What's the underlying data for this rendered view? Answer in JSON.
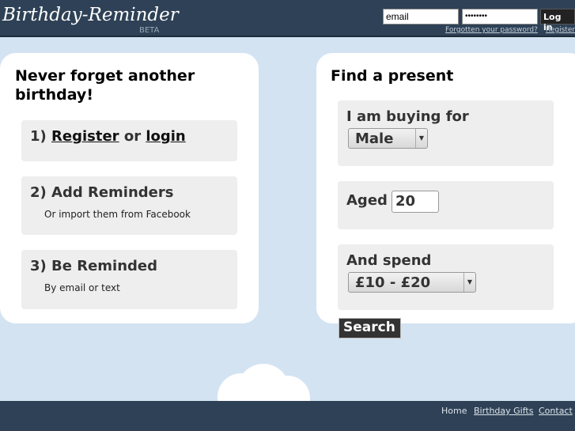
{
  "header": {
    "logo": "Birthday-Reminder",
    "beta": "BETA",
    "email_value": "email",
    "password_value": "••••••••",
    "login_label": "Log in",
    "forgot_link": "Forgotten your password?",
    "register_link": "Register"
  },
  "left": {
    "title": "Never forget another birthday!",
    "step1_prefix": "1) ",
    "step1_register": "Register",
    "step1_or": " or ",
    "step1_login": "login",
    "step2_title": "2) Add Reminders",
    "step2_sub": "Or import them from Facebook",
    "step3_title": "3) Be Reminded",
    "step3_sub": "By email or text"
  },
  "right": {
    "title": "Find a present",
    "buying_label": "I am buying for",
    "buying_value": "Male",
    "aged_label": "Aged",
    "aged_value": "20",
    "spend_label": "And spend",
    "spend_value": "£10 - £20",
    "search_label": "Search"
  },
  "footer": {
    "links": [
      "Home",
      "Birthday Gifts",
      "Contact"
    ]
  }
}
